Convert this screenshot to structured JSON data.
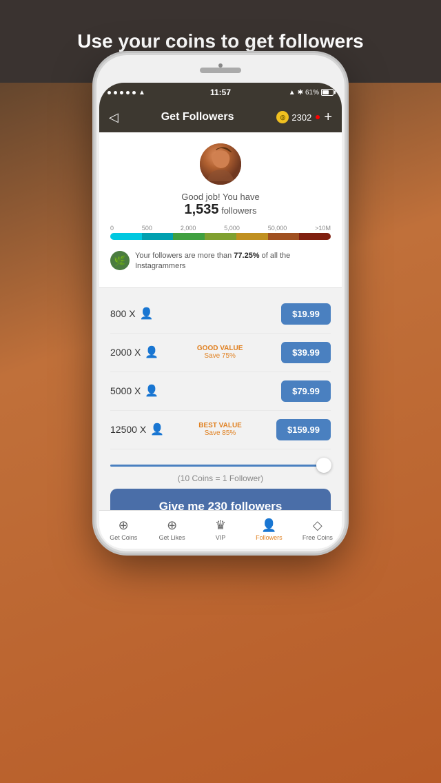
{
  "page": {
    "background_headline": "Use your coins to get followers"
  },
  "status_bar": {
    "time": "11:57",
    "battery_percent": "61%",
    "dots": [
      "•",
      "•",
      "•",
      "•",
      "•"
    ]
  },
  "nav_bar": {
    "title": "Get Followers",
    "coin_count": "2302",
    "back_icon": "◁",
    "plus_icon": "+"
  },
  "profile": {
    "greeting": "Good job! You have",
    "follower_count": "1,535",
    "follower_label": "followers",
    "progress_labels": [
      "0",
      "500",
      "2,000",
      "5,000",
      "50,000",
      ">10M"
    ],
    "stats_text": "Your followers are more than ",
    "stats_percent": "77.25%",
    "stats_suffix": " of all the Instagrammers"
  },
  "packages": [
    {
      "amount": "800",
      "price": "$19.99",
      "tag": "",
      "save": ""
    },
    {
      "amount": "2000",
      "price": "$39.99",
      "tag": "GOOD VALUE",
      "save": "Save 75%"
    },
    {
      "amount": "5000",
      "price": "$79.99",
      "tag": "",
      "save": ""
    },
    {
      "amount": "12500",
      "price": "$159.99",
      "tag": "BEST VALUE",
      "save": "Save 85%"
    }
  ],
  "slider": {
    "coins_label": "(10 Coins = 1 Follower)"
  },
  "cta_button": {
    "label": "Give me 230 followers"
  },
  "tab_bar": {
    "items": [
      {
        "label": "Get Coins",
        "icon": "⊕",
        "active": false
      },
      {
        "label": "Get Likes",
        "icon": "⊕",
        "active": false
      },
      {
        "label": "VIP",
        "icon": "♛",
        "active": false
      },
      {
        "label": "Followers",
        "icon": "👤",
        "active": true
      },
      {
        "label": "Free Coins",
        "icon": "◇",
        "active": false
      }
    ]
  }
}
